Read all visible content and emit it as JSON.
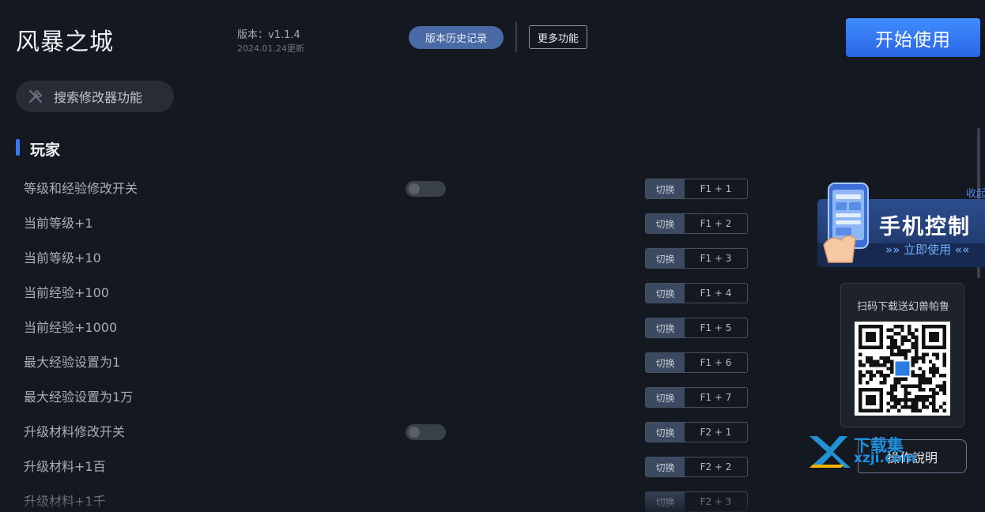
{
  "header": {
    "app_title": "风暴之城",
    "version_text": "版本：v1.1.4",
    "updated_text": "2024.01.24更新",
    "history_button": "版本历史记录",
    "more_button": "更多功能",
    "start_button": "开始使用"
  },
  "search": {
    "label": "搜索修改器功能",
    "icon": "tools-icon"
  },
  "section": {
    "title": "玩家",
    "accent_color": "#3a78f0"
  },
  "rows": [
    {
      "label": "等级和经验修改开关",
      "toggle": true,
      "switch": "切换",
      "key": "F1 + 1"
    },
    {
      "label": "当前等级+1",
      "toggle": false,
      "switch": "切换",
      "key": "F1 + 2"
    },
    {
      "label": "当前等级+10",
      "toggle": false,
      "switch": "切换",
      "key": "F1 + 3"
    },
    {
      "label": "当前经验+100",
      "toggle": false,
      "switch": "切换",
      "key": "F1 + 4"
    },
    {
      "label": "当前经验+1000",
      "toggle": false,
      "switch": "切换",
      "key": "F1 + 5"
    },
    {
      "label": "最大经验设置为1",
      "toggle": false,
      "switch": "切换",
      "key": "F1 + 6"
    },
    {
      "label": "最大经验设置为1万",
      "toggle": false,
      "switch": "切换",
      "key": "F1 + 7"
    },
    {
      "label": "升级材料修改开关",
      "toggle": true,
      "switch": "切换",
      "key": "F2 + 1"
    },
    {
      "label": "升级材料+1百",
      "toggle": false,
      "switch": "切换",
      "key": "F2 + 2"
    },
    {
      "label": "升级材料+1千",
      "toggle": false,
      "switch": "切换",
      "key": "F2 + 3"
    }
  ],
  "side": {
    "collapse_text": "收起",
    "banner_title": "手机控制",
    "banner_sub": "»» 立即使用 ««",
    "qr_caption": "扫码下载送幻兽帕鲁",
    "manual_button": "操作說明",
    "watermark_top": "下载集",
    "watermark_bottom": "xzji.com"
  },
  "colors": {
    "background": "#141820",
    "primary": "#2f7bf5",
    "banner": "#2c4d8e"
  }
}
